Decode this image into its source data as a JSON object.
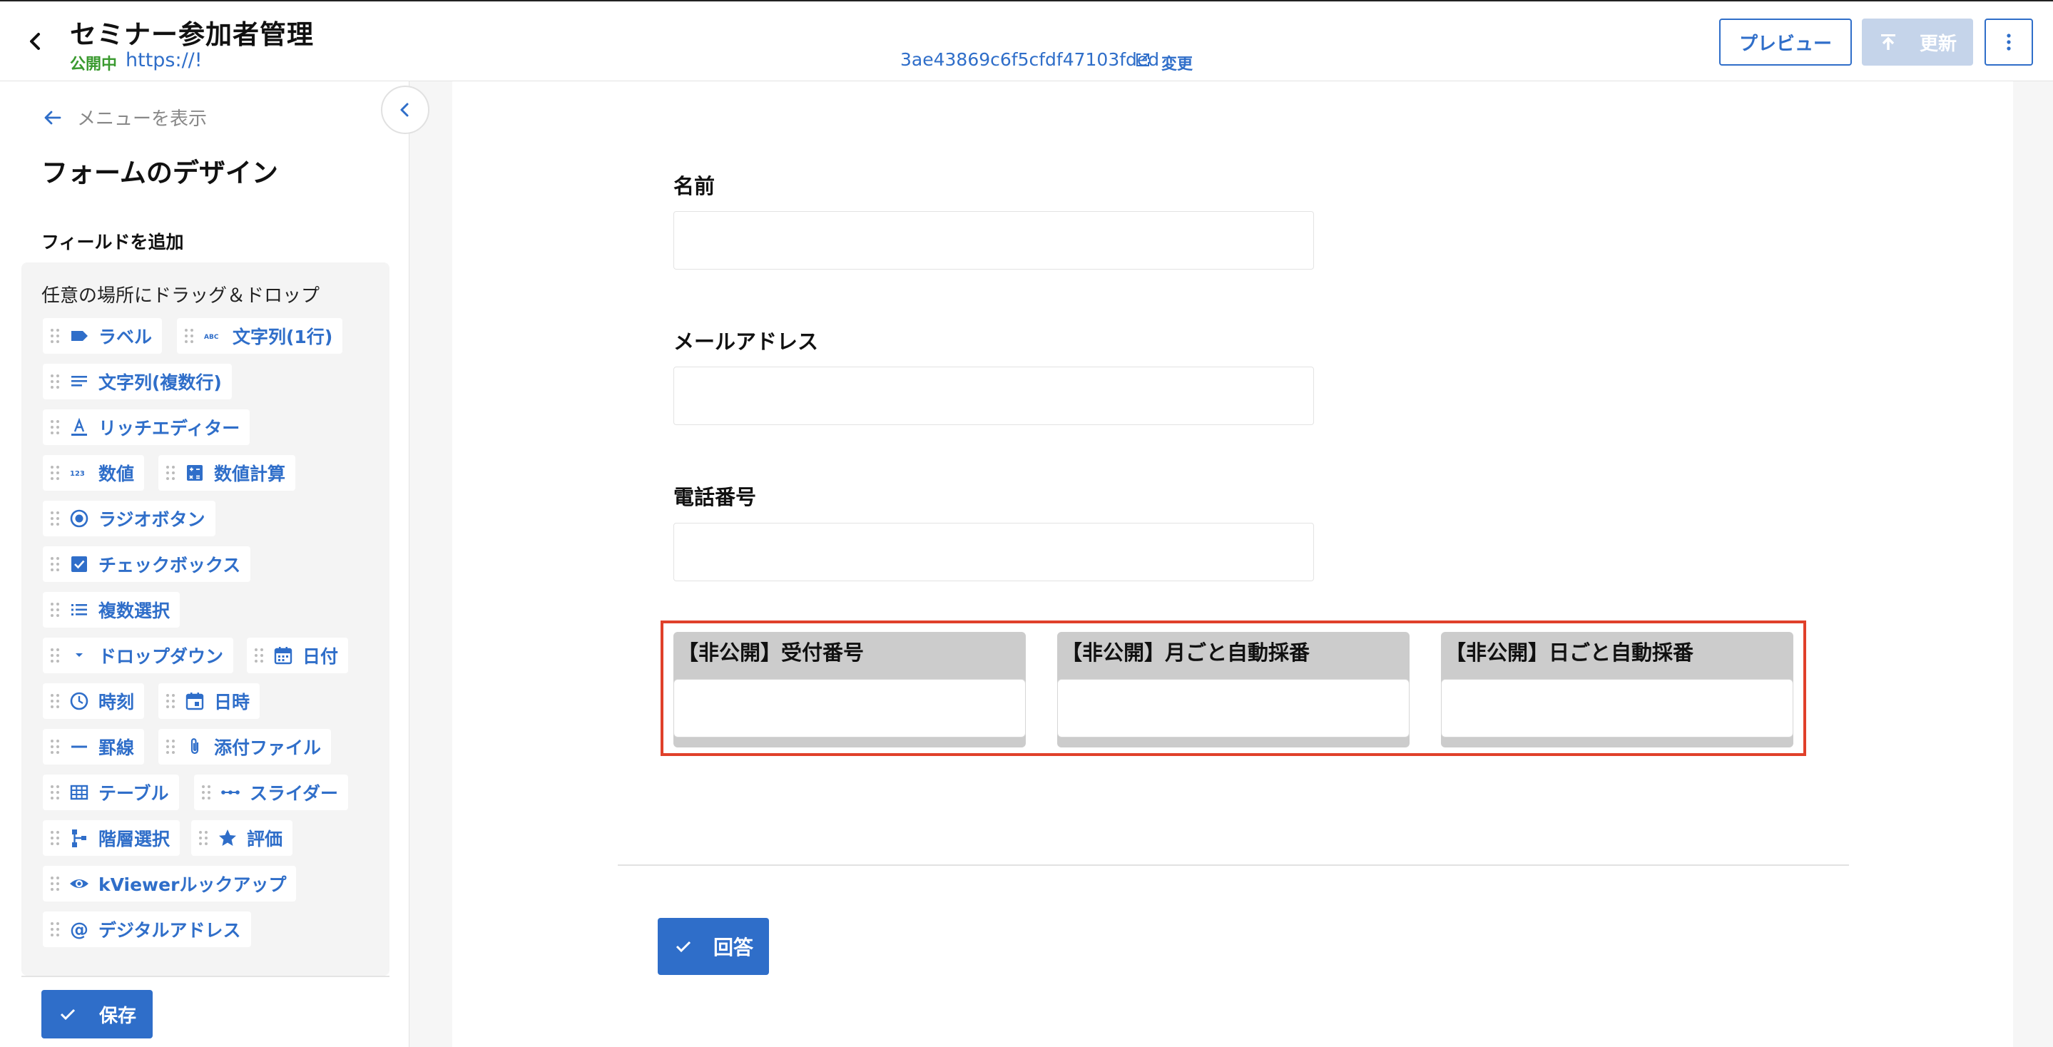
{
  "header": {
    "title": "セミナー参加者管理",
    "status": "公開中",
    "url_start": "https://!",
    "url_end": "3ae43869c6f5cfdf47103fded",
    "change_label": "変更",
    "preview_label": "プレビュー",
    "update_label": "更新"
  },
  "sidebar": {
    "show_menu_label": "メニューを表示",
    "design_title": "フォームのデザイン",
    "add_field_label": "フィールドを追加",
    "drag_hint": "任意の場所にドラッグ＆ドロップ",
    "fields": [
      {
        "label": "ラベル",
        "icon": "label-icon"
      },
      {
        "label": "文字列(1行)",
        "icon": "abc-icon"
      },
      {
        "label": "文字列(複数行)",
        "icon": "multiline-icon"
      },
      {
        "label": "リッチエディター",
        "icon": "text-format-icon"
      },
      {
        "label": "数値",
        "icon": "number-icon"
      },
      {
        "label": "数値計算",
        "icon": "calculator-icon"
      },
      {
        "label": "ラジオボタン",
        "icon": "radio-icon"
      },
      {
        "label": "チェックボックス",
        "icon": "checkbox-icon"
      },
      {
        "label": "複数選択",
        "icon": "list-icon"
      },
      {
        "label": "ドロップダウン",
        "icon": "dropdown-icon"
      },
      {
        "label": "日付",
        "icon": "calendar-icon"
      },
      {
        "label": "時刻",
        "icon": "clock-icon"
      },
      {
        "label": "日時",
        "icon": "event-icon"
      },
      {
        "label": "罫線",
        "icon": "line-icon"
      },
      {
        "label": "添付ファイル",
        "icon": "attachment-icon"
      },
      {
        "label": "テーブル",
        "icon": "table-icon"
      },
      {
        "label": "スライダー",
        "icon": "slider-icon"
      },
      {
        "label": "階層選択",
        "icon": "hierarchy-icon"
      },
      {
        "label": "評価",
        "icon": "star-icon"
      },
      {
        "label": "kViewerルックアップ",
        "icon": "eye-icon"
      },
      {
        "label": "デジタルアドレス",
        "icon": "at-icon"
      }
    ],
    "save_label": "保存"
  },
  "form": {
    "fields": [
      {
        "label": "名前"
      },
      {
        "label": "メールアドレス"
      },
      {
        "label": "電話番号"
      }
    ],
    "hidden_fields": [
      {
        "label": "【非公開】受付番号"
      },
      {
        "label": "【非公開】月ごと自動採番"
      },
      {
        "label": "【非公開】日ごと自動採番"
      }
    ],
    "submit_label": "回答"
  },
  "colors": {
    "accent": "#2f6ec9",
    "published": "#3a9a2f",
    "highlight": "#e0402a",
    "disabled": "#c5d4ea"
  }
}
